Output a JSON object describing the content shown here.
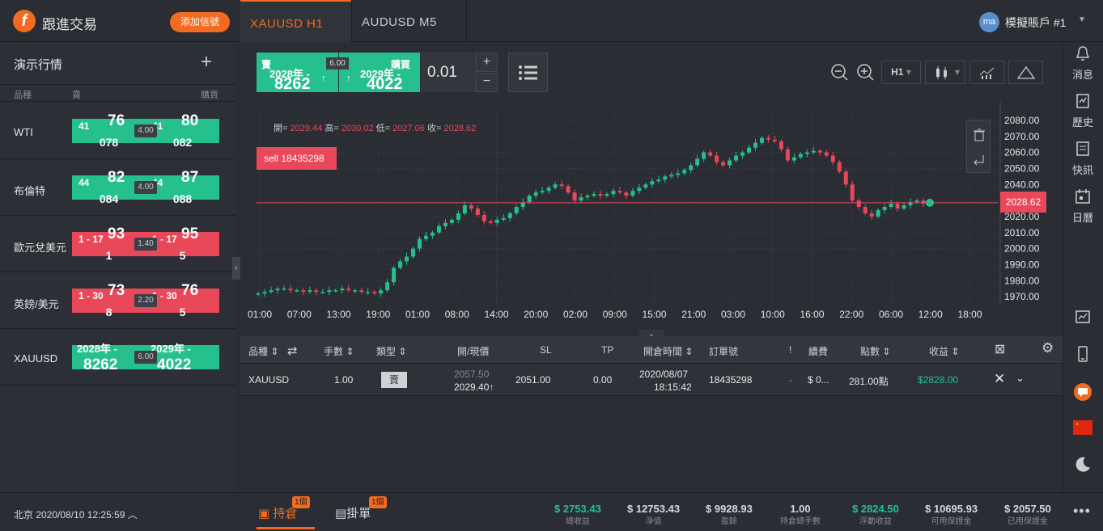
{
  "app": {
    "name": "跟進交易",
    "add_signal": "添加信號"
  },
  "tabs": [
    {
      "label": "XAUUSD  H1"
    },
    {
      "label": "AUDUSD  M5"
    }
  ],
  "account": {
    "avatar": "ma",
    "name": "模擬賬戶 #1"
  },
  "watchlist": {
    "title": "演示行情",
    "headers": {
      "symbol": "品種",
      "sell": "賣",
      "buy": "購買"
    },
    "items": [
      {
        "name": "WTI",
        "color": "#26c08f",
        "spread": "4.00",
        "sell": {
          "a": "41",
          "b": "76",
          "c": "078"
        },
        "buy": {
          "a": "41",
          "b": "80",
          "c": "082"
        }
      },
      {
        "name": "布倫特",
        "color": "#26c08f",
        "spread": "4.00",
        "sell": {
          "a": "44",
          "b": "82",
          "c": "084"
        },
        "buy": {
          "a": "44",
          "b": "87",
          "c": "088"
        }
      },
      {
        "name": "歐元兌美元",
        "color": "#e9475a",
        "spread": "1.40",
        "sell": {
          "a": "1 - 17",
          "b": "93",
          "c": "1"
        },
        "buy": {
          "a": "1 - 17",
          "b": "95",
          "c": "5"
        }
      },
      {
        "name": "英鎊/美元",
        "color": "#e9475a",
        "spread": "2.20",
        "sell": {
          "a": "1 - 30",
          "b": "73",
          "c": "8"
        },
        "buy": {
          "a": "1 - 30",
          "b": "76",
          "c": "5"
        }
      },
      {
        "name": "XAUUSD",
        "color": "#26c08f",
        "spread": "6.00",
        "sell": {
          "a": "2028年 -",
          "b": "8262",
          "c": ""
        },
        "buy": {
          "a": "2029年 -",
          "b": "4022",
          "c": ""
        }
      }
    ]
  },
  "clock": "北京 2020/08/10 12:25:59",
  "trade": {
    "sell_label": "賣",
    "sell_top": "2028年 -",
    "sell_big": "8262",
    "buy_label": "購買",
    "buy_top": "2029年 -",
    "buy_big": "4022",
    "spread": "6.00",
    "lot": "0.01",
    "timeframe": "H1"
  },
  "chart": {
    "ohlc": {
      "open_label": "開=",
      "open": "2029.44",
      "high_label": "高=",
      "high": "2030.02",
      "low_label": "低=",
      "low": "2027.06",
      "close_label": "收=",
      "close": "2028.62"
    },
    "sell_tag": "sell 18435298",
    "price_tag": "2028.62",
    "y_ticks": [
      "2080.00",
      "2070.00",
      "2060.00",
      "2050.00",
      "2040.00",
      "2030.00",
      "2020.00",
      "2010.00",
      "2000.00",
      "1990.00",
      "1980.00",
      "1970.00"
    ],
    "x_ticks": [
      "01:00",
      "07:00",
      "13:00",
      "19:00",
      "01:00",
      "08:00",
      "14:00",
      "20:00",
      "02:00",
      "09:00",
      "15:00",
      "21:00",
      "03:00",
      "10:00",
      "16:00",
      "22:00",
      "06:00",
      "12:00",
      "18:00"
    ],
    "current_price": 2028.62,
    "close_values": [
      1972,
      1973,
      1974,
      1975,
      1975,
      1974,
      1974,
      1973,
      1974,
      1973,
      1973,
      1974,
      1974,
      1975,
      1974,
      1974,
      1973,
      1973,
      1972,
      1974,
      1979,
      1988,
      1992,
      1995,
      2000,
      2006,
      2008,
      2010,
      2014,
      2016,
      2018,
      2022,
      2027,
      2025,
      2021,
      2017,
      2016,
      2018,
      2019,
      2022,
      2026,
      2029,
      2033,
      2035,
      2036,
      2038,
      2040,
      2039,
      2035,
      2030,
      2032,
      2033,
      2034,
      2033,
      2034,
      2036,
      2035,
      2033,
      2036,
      2038,
      2040,
      2042,
      2043,
      2045,
      2046,
      2047,
      2049,
      2052,
      2056,
      2060,
      2058,
      2054,
      2052,
      2055,
      2058,
      2060,
      2063,
      2066,
      2069,
      2068,
      2067,
      2062,
      2055,
      2057,
      2059,
      2060,
      2061,
      2060,
      2058,
      2054,
      2048,
      2040,
      2030,
      2026,
      2022,
      2020,
      2024,
      2026,
      2028,
      2025,
      2027,
      2029,
      2030,
      2028,
      2028.62
    ]
  },
  "positions": {
    "headers": [
      "品種",
      "手數",
      "類型",
      "開/現價",
      "SL",
      "TP",
      "開倉時間",
      "訂單號",
      "!",
      "續費",
      "點數",
      "收益"
    ],
    "row": {
      "symbol": "XAUUSD",
      "lots": "1.00",
      "type": "賣",
      "open_price": "2057.50",
      "cur_price": "2029.40↑",
      "sl": "2051.00",
      "tp": "0.00",
      "date": "2020/08/07",
      "time": "18:15:42",
      "order": "18435298",
      "dash": "-",
      "fee": "$ 0...",
      "points": "281.00點",
      "profit": "$2828.00"
    }
  },
  "bottom": {
    "tab_positions": "持倉",
    "tab_positions_badge": "1個",
    "tab_orders": "掛單",
    "tab_orders_badge": "1個",
    "stats": [
      {
        "value": "$ 2753.43",
        "label": "總收益",
        "color": "#26c08f"
      },
      {
        "value": "$ 12753.43",
        "label": "淨值",
        "color": "#d6d8dc"
      },
      {
        "value": "$ 9928.93",
        "label": "盈餘",
        "color": "#d6d8dc"
      },
      {
        "value": "1.00",
        "label": "持倉總手數",
        "color": "#d6d8dc"
      },
      {
        "value": "$ 2824.50",
        "label": "浮動收益",
        "color": "#26c08f"
      },
      {
        "value": "$ 10695.93",
        "label": "可用保證金",
        "color": "#d6d8dc"
      },
      {
        "value": "$ 2057.50",
        "label": "已用保證金",
        "color": "#d6d8dc"
      }
    ]
  },
  "sidebar": {
    "news": "消息",
    "history": "歷史",
    "flash": "快訊",
    "calendar": "日曆"
  },
  "colors": {
    "accent": "#f26b21",
    "up": "#26c08f",
    "down": "#e9475a"
  }
}
